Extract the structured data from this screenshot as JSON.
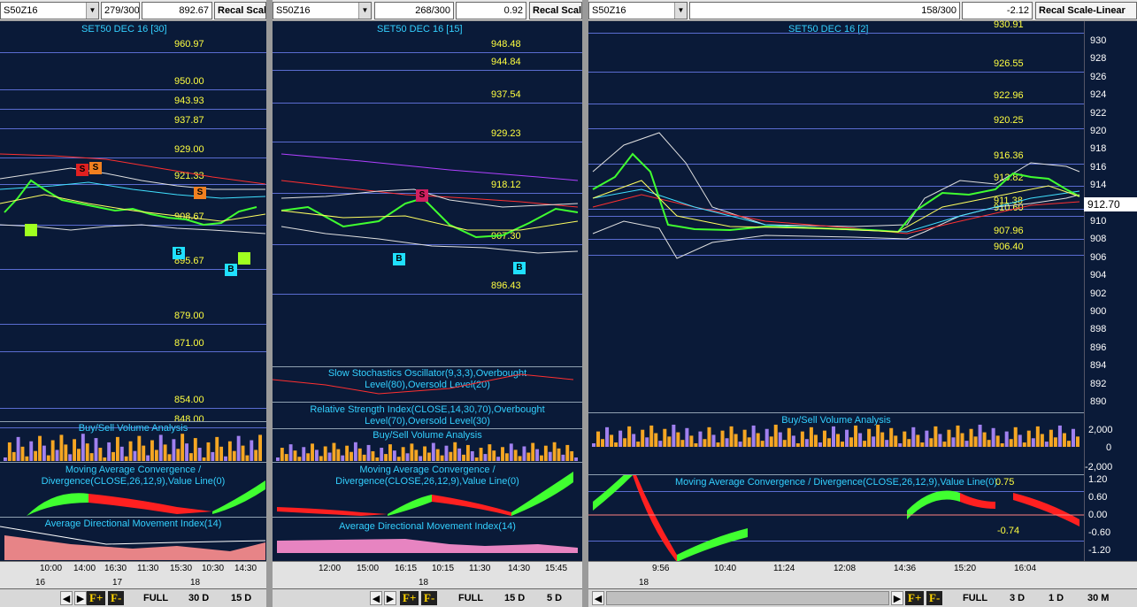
{
  "panels": [
    {
      "symbol": "S50Z16",
      "bar_count": "279/300",
      "last_value": "892.67",
      "recal_label": "Recal Scal",
      "chart_title": "SET50 DEC 16  [30]",
      "levels": [
        "960.97",
        "950.00",
        "943.93",
        "937.87",
        "929.00",
        "921.33",
        "908.67",
        "895.67",
        "879.00",
        "871.00",
        "854.00",
        "848.00"
      ],
      "markers": [
        "S",
        "S",
        "S",
        "B",
        "B"
      ],
      "studies": [
        "Buy/Sell Volume Analysis",
        "Moving Average Convergence / Divergence(CLOSE,26,12,9),Value Line(0)",
        "Average Directional Movement Index(14)"
      ],
      "time_labels": [
        "10:00",
        "14:00",
        "16:30",
        "11:30",
        "15:30",
        "10:30",
        "14:30"
      ],
      "date_labels": [
        "16",
        "17",
        "18"
      ],
      "toolbar": {
        "full": "FULL",
        "p1": "30 D",
        "p2": "15 D"
      }
    },
    {
      "symbol": "S50Z16",
      "bar_count": "268/300",
      "last_value": "0.92",
      "recal_label": "Recal Scal",
      "chart_title": "SET50 DEC 16  [15]",
      "levels": [
        "948.48",
        "944.84",
        "937.54",
        "929.23",
        "918.12",
        "907.30",
        "896.43"
      ],
      "markers": [
        "S",
        "B",
        "B"
      ],
      "studies": [
        "Slow Stochastics Oscillator(9,3,3),Overbought Level(80),Oversold Level(20)",
        "Relative Strength Index(CLOSE,14,30,70),Overbought Level(70),Oversold Level(30)",
        "Buy/Sell Volume Analysis",
        "Moving Average Convergence / Divergence(CLOSE,26,12,9),Value Line(0)",
        "Average Directional Movement Index(14)"
      ],
      "time_labels": [
        "12:00",
        "15:00",
        "16:15",
        "10:15",
        "11:30",
        "14:30",
        "15:45"
      ],
      "date_labels": [
        "18"
      ],
      "toolbar": {
        "full": "FULL",
        "p1": "15 D",
        "p2": "5 D"
      }
    },
    {
      "symbol": "S50Z16",
      "bar_count": "158/300",
      "last_value": "-2.12",
      "recal_label": "Recal Scale-Linear",
      "chart_title": "SET50 DEC 16  [2]",
      "levels": [
        "930.91",
        "926.55",
        "922.96",
        "920.25",
        "916.36",
        "913.82",
        "911.38",
        "910.60",
        "907.96",
        "906.40"
      ],
      "current_price": "912.70",
      "price_axis": [
        "930",
        "928",
        "926",
        "924",
        "922",
        "920",
        "918",
        "916",
        "914",
        "912",
        "910",
        "908",
        "906",
        "904",
        "902",
        "900",
        "898",
        "896",
        "894",
        "892",
        "890"
      ],
      "studies": [
        "Buy/Sell Volume Analysis",
        "Moving Average Convergence / Divergence(CLOSE,26,12,9),Value Line(0)"
      ],
      "volume_axis": [
        "2,000",
        "0",
        "-2,000"
      ],
      "macd_axis": [
        "1.20",
        "0.60",
        "0.00",
        "-0.60",
        "-1.20"
      ],
      "macd_levels": [
        "0.75",
        "-0.74"
      ],
      "time_labels": [
        "9:56",
        "10:40",
        "11:24",
        "12:08",
        "14:36",
        "15:20",
        "16:04"
      ],
      "date_labels": [
        "18"
      ],
      "toolbar": {
        "full": "FULL",
        "p1": "3 D",
        "p2": "1 D",
        "p3": "30 M"
      }
    }
  ],
  "colors": {
    "background": "#0a1a38",
    "level": "#ffff40",
    "title": "#33d0ff",
    "grid": "#5a6cd0",
    "bullish": "#44ff22",
    "bearish": "#ff2020",
    "volume_buy": "#f5a623",
    "volume_sell": "#a080f0"
  },
  "fbuttons": [
    "F+",
    "F-"
  ]
}
